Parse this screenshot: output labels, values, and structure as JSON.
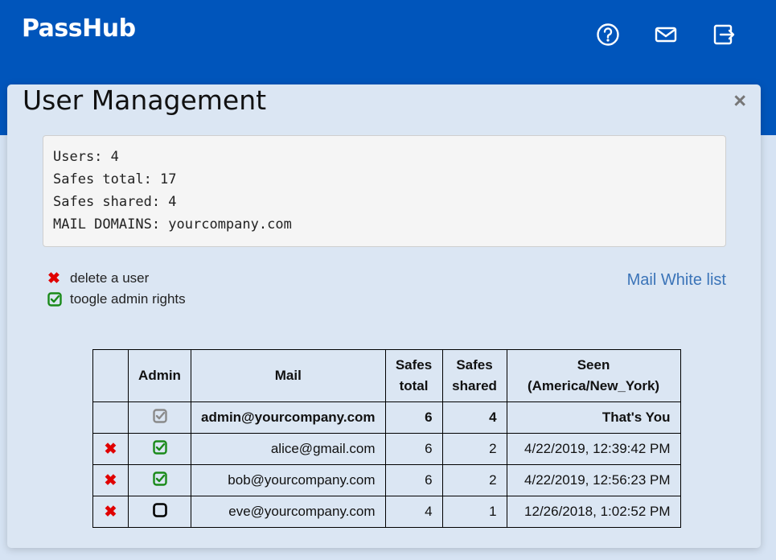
{
  "app": {
    "logo": "PassHub"
  },
  "header": {
    "icons": [
      "help-icon",
      "mail-icon",
      "logout-icon"
    ]
  },
  "modal": {
    "title": "User Management",
    "close": "×",
    "stats": [
      "Users: 4",
      "Safes total: 17",
      "Safes shared: 4",
      "MAIL DOMAINS: yourcompany.com"
    ],
    "legend": {
      "delete": "delete a user",
      "toggle": "toogle admin rights"
    },
    "whitelist_link": "Mail White list"
  },
  "table": {
    "headers": [
      "",
      "Admin",
      "Mail",
      "Safes total",
      "Safes shared",
      "Seen (America/New_York)"
    ],
    "rows": [
      {
        "mail": "admin@yourcompany.com",
        "safes_total": "6",
        "safes_shared": "4",
        "seen": "That's You",
        "admin": "admin-disabled",
        "deletable": false
      },
      {
        "mail": "alice@gmail.com",
        "safes_total": "6",
        "safes_shared": "2",
        "seen": "4/22/2019, 12:39:42 PM",
        "admin": "admin",
        "deletable": true
      },
      {
        "mail": "bob@yourcompany.com",
        "safes_total": "6",
        "safes_shared": "2",
        "seen": "4/22/2019, 12:56:23 PM",
        "admin": "admin",
        "deletable": true
      },
      {
        "mail": "eve@yourcompany.com",
        "safes_total": "4",
        "safes_shared": "1",
        "seen": "12/26/2018, 1:02:52 PM",
        "admin": "not-admin",
        "deletable": true
      }
    ]
  },
  "colors": {
    "header": "#0055bb",
    "delete": "#e00000",
    "admin": "#1a8a1a",
    "link": "#3b74b8"
  }
}
